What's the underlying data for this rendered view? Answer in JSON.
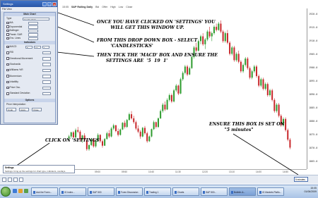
{
  "chart": {
    "header": [
      "15:05",
      "S&P Rolling Daily",
      "Bid",
      "Offer",
      "High",
      "Low",
      "Close"
    ],
    "price_ticks": [
      "1920.0",
      "1915.0",
      "1910.0",
      "1905.0",
      "1900.0",
      "1895.0",
      "1890.0",
      "1885.0",
      "1880.0",
      "1875.0",
      "1870.0",
      "1865.0"
    ],
    "time_ticks": [
      "08:10",
      "09:00",
      "09:50",
      "10:40",
      "11:30",
      "12:20",
      "13:10",
      "14:00",
      "14:50"
    ],
    "colors": {
      "up": "#2e9b2e",
      "down": "#c8282b"
    },
    "candles": [
      [
        13,
        14,
        12,
        13.5
      ],
      [
        13.5,
        15,
        13,
        14.8
      ],
      [
        14.8,
        15.2,
        13,
        13.2
      ],
      [
        13.2,
        16,
        13,
        15.5
      ],
      [
        15.5,
        16.5,
        14.5,
        15
      ],
      [
        15,
        15.5,
        12,
        12.5
      ],
      [
        12.5,
        14,
        11.5,
        13.8
      ],
      [
        13.8,
        14.5,
        12,
        12.3
      ],
      [
        12.3,
        12.8,
        9,
        9.5
      ],
      [
        9.5,
        11,
        9,
        10.8
      ],
      [
        10.8,
        13,
        10.5,
        12.6
      ],
      [
        12.6,
        13,
        10,
        10.4
      ],
      [
        10.4,
        12.5,
        10,
        12
      ],
      [
        12,
        14.5,
        11.8,
        14
      ],
      [
        14,
        14.2,
        11.5,
        12
      ],
      [
        12,
        12.5,
        10,
        10.6
      ],
      [
        10.6,
        13,
        10.5,
        12.7
      ],
      [
        12.7,
        15,
        12.5,
        14.5
      ],
      [
        14.5,
        15.5,
        13,
        13.5
      ],
      [
        13.5,
        16.5,
        13.2,
        16
      ],
      [
        16,
        17.5,
        15.5,
        17
      ],
      [
        17,
        17.2,
        14.8,
        15.2
      ],
      [
        15.2,
        16,
        13.5,
        14
      ],
      [
        14,
        16,
        13.8,
        15.7
      ],
      [
        15.7,
        18,
        15.5,
        17.8
      ],
      [
        17.8,
        18.5,
        16,
        16.5
      ],
      [
        16.5,
        19,
        16.2,
        18.7
      ],
      [
        18.7,
        21,
        18.5,
        20.5
      ],
      [
        20.5,
        21.5,
        18.8,
        19.2
      ],
      [
        19.2,
        20,
        17.5,
        18
      ],
      [
        18,
        18.5,
        15.5,
        16
      ],
      [
        16,
        17,
        14.5,
        15
      ],
      [
        15,
        15.5,
        12.8,
        13.5
      ],
      [
        13.5,
        16.5,
        13.2,
        16.2
      ],
      [
        16.2,
        16.8,
        14,
        14.5
      ],
      [
        14.5,
        15,
        11.5,
        12
      ],
      [
        12,
        13.8,
        11.8,
        13.5
      ],
      [
        13.5,
        16,
        13.2,
        15.8
      ],
      [
        15.8,
        18.5,
        15.5,
        18
      ],
      [
        18,
        18.2,
        16,
        16.5
      ],
      [
        16.5,
        19.5,
        16.2,
        19.2
      ],
      [
        19.2,
        22,
        19,
        21.5
      ],
      [
        21.5,
        24,
        21,
        23.5
      ],
      [
        23.5,
        24.5,
        21.5,
        22
      ],
      [
        22,
        25.5,
        21.8,
        25
      ],
      [
        25,
        27,
        24.5,
        26.5
      ],
      [
        26.5,
        27,
        24,
        24.5
      ],
      [
        24.5,
        28.5,
        24.2,
        28
      ],
      [
        28,
        30,
        27.5,
        29.5
      ],
      [
        29.5,
        29.8,
        26.5,
        27
      ],
      [
        27,
        32,
        26.8,
        31.5
      ],
      [
        31.5,
        34,
        31,
        33.5
      ],
      [
        33.5,
        36,
        33,
        35.5
      ],
      [
        35.5,
        36,
        32.5,
        33
      ],
      [
        33,
        35.5,
        32.8,
        35
      ],
      [
        35,
        39,
        34.8,
        38.5
      ],
      [
        38.5,
        42,
        38,
        41.5
      ],
      [
        41.5,
        43,
        40,
        40.5
      ],
      [
        40.5,
        44,
        40.2,
        43.5
      ],
      [
        43.5,
        45.5,
        42.5,
        45
      ],
      [
        45,
        46,
        42,
        42.5
      ],
      [
        42.5,
        44.5,
        41,
        44
      ],
      [
        44,
        47,
        43.5,
        46.5
      ],
      [
        46.5,
        48,
        44.5,
        45
      ],
      [
        45,
        46.5,
        43.5,
        46
      ],
      [
        46,
        48.5,
        45.5,
        48
      ],
      [
        48,
        49,
        46.5,
        47
      ],
      [
        47,
        49.5,
        46.8,
        49
      ],
      [
        49,
        50,
        46,
        46.5
      ],
      [
        46.5,
        47,
        43,
        43.5
      ],
      [
        43.5,
        46.5,
        43,
        46
      ],
      [
        46,
        47,
        42.5,
        43
      ],
      [
        43,
        43.5,
        39,
        39.5
      ],
      [
        39.5,
        42,
        39,
        41.5
      ],
      [
        41.5,
        42,
        37,
        37.5
      ],
      [
        37.5,
        40,
        37,
        39.5
      ],
      [
        39.5,
        40.5,
        36.5,
        37
      ],
      [
        37,
        37.5,
        33.5,
        34
      ],
      [
        34,
        36.5,
        33.5,
        36
      ],
      [
        36,
        38.5,
        35.5,
        38
      ],
      [
        38,
        38.5,
        34.5,
        35
      ],
      [
        35,
        35.5,
        31.5,
        32
      ],
      [
        32,
        34.5,
        31.5,
        34
      ],
      [
        34,
        36,
        33.5,
        35.5
      ],
      [
        35.5,
        36,
        32,
        32.5
      ],
      [
        32.5,
        33,
        29,
        29.5
      ],
      [
        29.5,
        32,
        29,
        31.5
      ],
      [
        31.5,
        32,
        28,
        28.5
      ],
      [
        28.5,
        30.5,
        28,
        30
      ],
      [
        30,
        30.5,
        26,
        26.5
      ],
      [
        26.5,
        28.5,
        26,
        28
      ],
      [
        28,
        28.5,
        24.5,
        25
      ],
      [
        25,
        25.5,
        21,
        21.5
      ],
      [
        21.5,
        24,
        21,
        23.5
      ],
      [
        23.5,
        24,
        19.5,
        20
      ],
      [
        20,
        20.5,
        16.5,
        17
      ],
      [
        17,
        19.5,
        16.5,
        19
      ],
      [
        19,
        19.5,
        15,
        15.5
      ],
      [
        15.5,
        16,
        12,
        12.5
      ],
      [
        12.5,
        13,
        9.5,
        10
      ]
    ]
  },
  "annotations": {
    "a1": "ONCE YOU HAVE CLICKED ON 'SETTINGS' YOU\n         WILL GET THIS WINDOW UP.",
    "a2": "FROM THIS DROP DOWN BOX - SELECT\n         'CANDLESTICKS'",
    "a3": "THEN TICK THE 'MACD' BOX AND ENSURE THE\n      SETTINGS ARE  '5  19  1'",
    "a4": "ENSURE THIS BOX IS SET ON\n          \"5 minutes\"",
    "a5": "CLICK ON 'SETTINGS'"
  },
  "settings_window": {
    "title": "Settings",
    "menu": "File  View",
    "panel_title": "Main Chart",
    "chart_type_label": "Type",
    "chart_type_value": "Candle Stick",
    "rows": [
      {
        "label": "MA",
        "checked": false
      },
      {
        "label": "Exponential",
        "checked": false
      },
      {
        "label": "Bollinger",
        "checked": false
      },
      {
        "label": "Parab. SAR",
        "checked": false
      },
      {
        "label": "Env. Lines",
        "checked": false
      }
    ],
    "indicators_title": "Indicators",
    "indicators": [
      {
        "label": "MACD",
        "checked": true
      },
      {
        "label": "RSI",
        "checked": false
      },
      {
        "label": "Directional Movement",
        "checked": false
      },
      {
        "label": "Stochastic",
        "checked": false
      },
      {
        "label": "Williams %R",
        "checked": false
      },
      {
        "label": "Momentum",
        "checked": false
      },
      {
        "label": "Volatility",
        "checked": false
      },
      {
        "label": "Price Osc.",
        "checked": false
      },
      {
        "label": "Standard Deviation",
        "checked": false
      }
    ],
    "macd_values": [
      "5",
      "19",
      "1"
    ],
    "options_title": "Options",
    "price_label": "Price Interpolation",
    "buttons": [
      "Undo",
      "Apply",
      "Close"
    ]
  },
  "status": {
    "label": "Settings",
    "desc": "Settings: bring up the settings for chart type, indicators, overlays."
  },
  "interval": "5 minutes",
  "taskbar": {
    "items": [
      "Ask the Forex...",
      "IG Index...",
      "S&P 500",
      "Forex Discussion",
      "Trading 1",
      "Charts",
      "S&P 500...",
      "Bulletin &...",
      "IG Markets Platfo..."
    ],
    "tray_time": "15:05",
    "tray_date": "01/06/2009"
  }
}
